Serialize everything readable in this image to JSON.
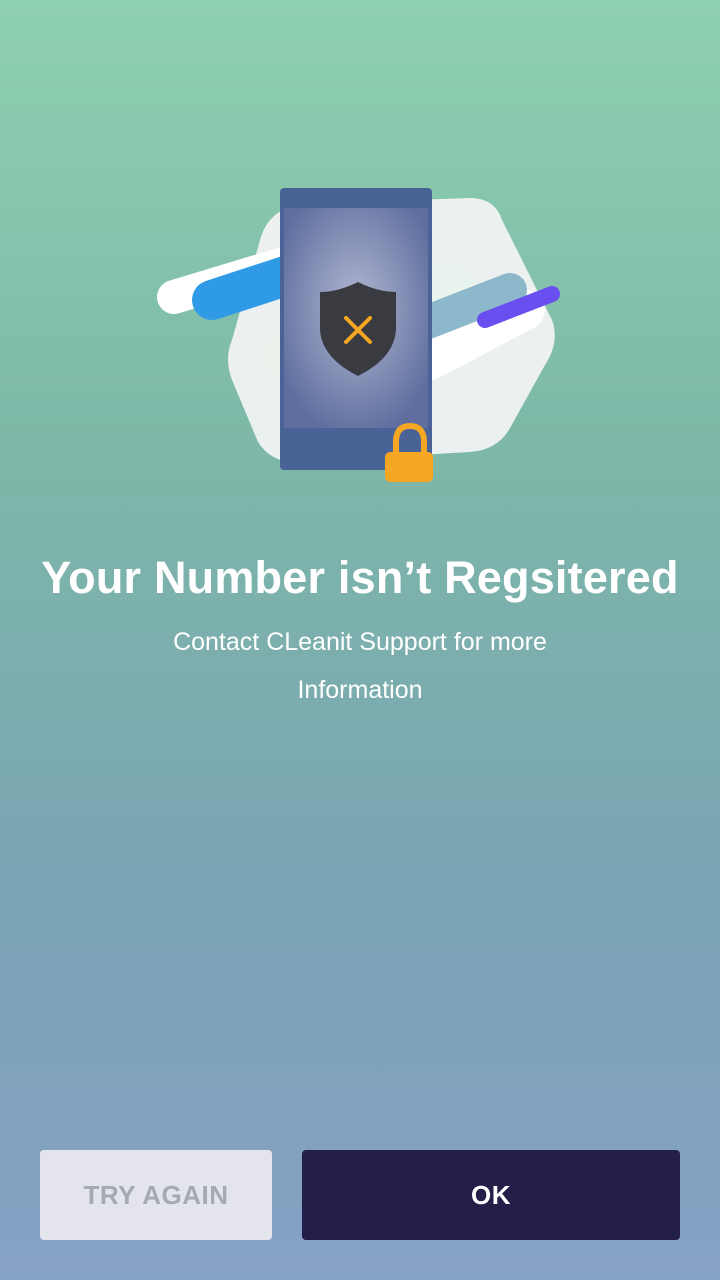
{
  "illustration": {
    "icons": [
      "phone-icon",
      "shield-x-icon",
      "padlock-icon",
      "hexagon-shape",
      "decorative-stripes"
    ],
    "colors": {
      "phone_body": "#4a6396",
      "phone_screen": "#8a93ba",
      "shield": "#3a3b40",
      "x_mark": "#f5a623",
      "padlock": "#f5a623",
      "stripe_blue": "#2f9be6",
      "stripe_purple": "#6a4ff0",
      "hexagon": "#f1f2f3"
    }
  },
  "message": {
    "title": "Your Number isn’t Regsitered",
    "subtitle": "Contact CLeanit Support for more Information"
  },
  "actions": {
    "try_again_label": "TRY AGAIN",
    "ok_label": "OK"
  },
  "colors": {
    "gradient_top": "#8ed1b0",
    "gradient_bottom": "#86a1c6",
    "ok_button": "#231f48",
    "try_again_button": "#e4e5ec",
    "try_again_text": "#a6a8b2"
  }
}
